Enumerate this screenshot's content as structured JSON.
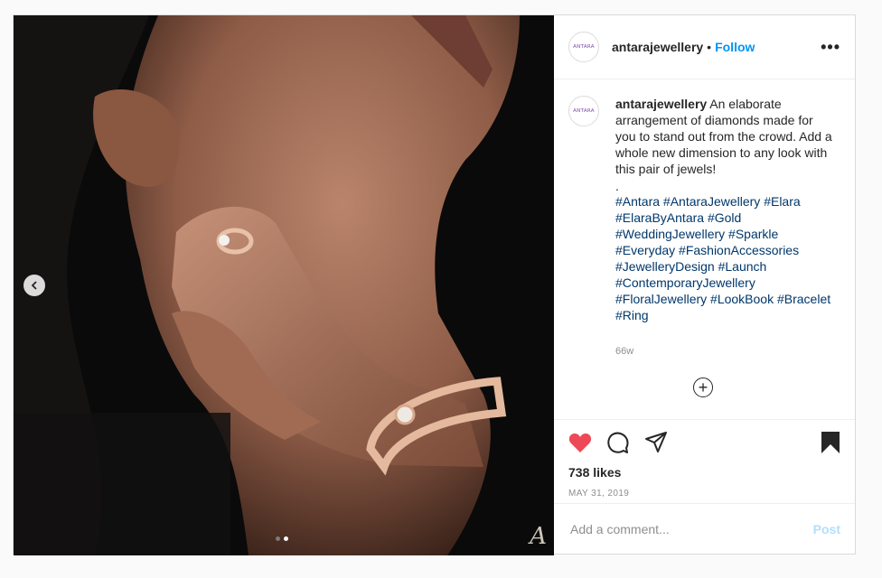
{
  "account": {
    "username": "antarajewellery",
    "avatar_text": "ANTARA",
    "separator": "•",
    "follow_label": "Follow",
    "more_label": "•••"
  },
  "caption": {
    "username": "antarajewellery",
    "text": " An elaborate arrangement of diamonds made for you to stand out from the crowd. Add a whole new dimension to any look with this pair of jewels!",
    "dot_line": ".",
    "hashtags": "#Antara #AntaraJewellery #Elara #ElaraByAntara #Gold #WeddingJewellery #Sparkle #Everyday #FashionAccessories #JewelleryDesign #Launch #ContemporaryJewellery #FloralJewellery #LookBook #Bracelet #Ring",
    "time_ago": "66w"
  },
  "load_more_label": "+",
  "engagement": {
    "likes": "738 likes",
    "date": "MAY 31, 2019"
  },
  "comment": {
    "placeholder": "Add a comment...",
    "post_label": "Post"
  },
  "media": {
    "signature": "A",
    "carousel_count": 2,
    "carousel_active": 2
  },
  "colors": {
    "like": "#ed4956",
    "link": "#0095f6",
    "hashtag": "#00376b",
    "post_disabled": "#b2dffc"
  },
  "icons": [
    "chevron-left-icon",
    "heart-icon",
    "comment-icon",
    "share-icon",
    "bookmark-icon",
    "more-icon",
    "plus-circle-icon"
  ]
}
